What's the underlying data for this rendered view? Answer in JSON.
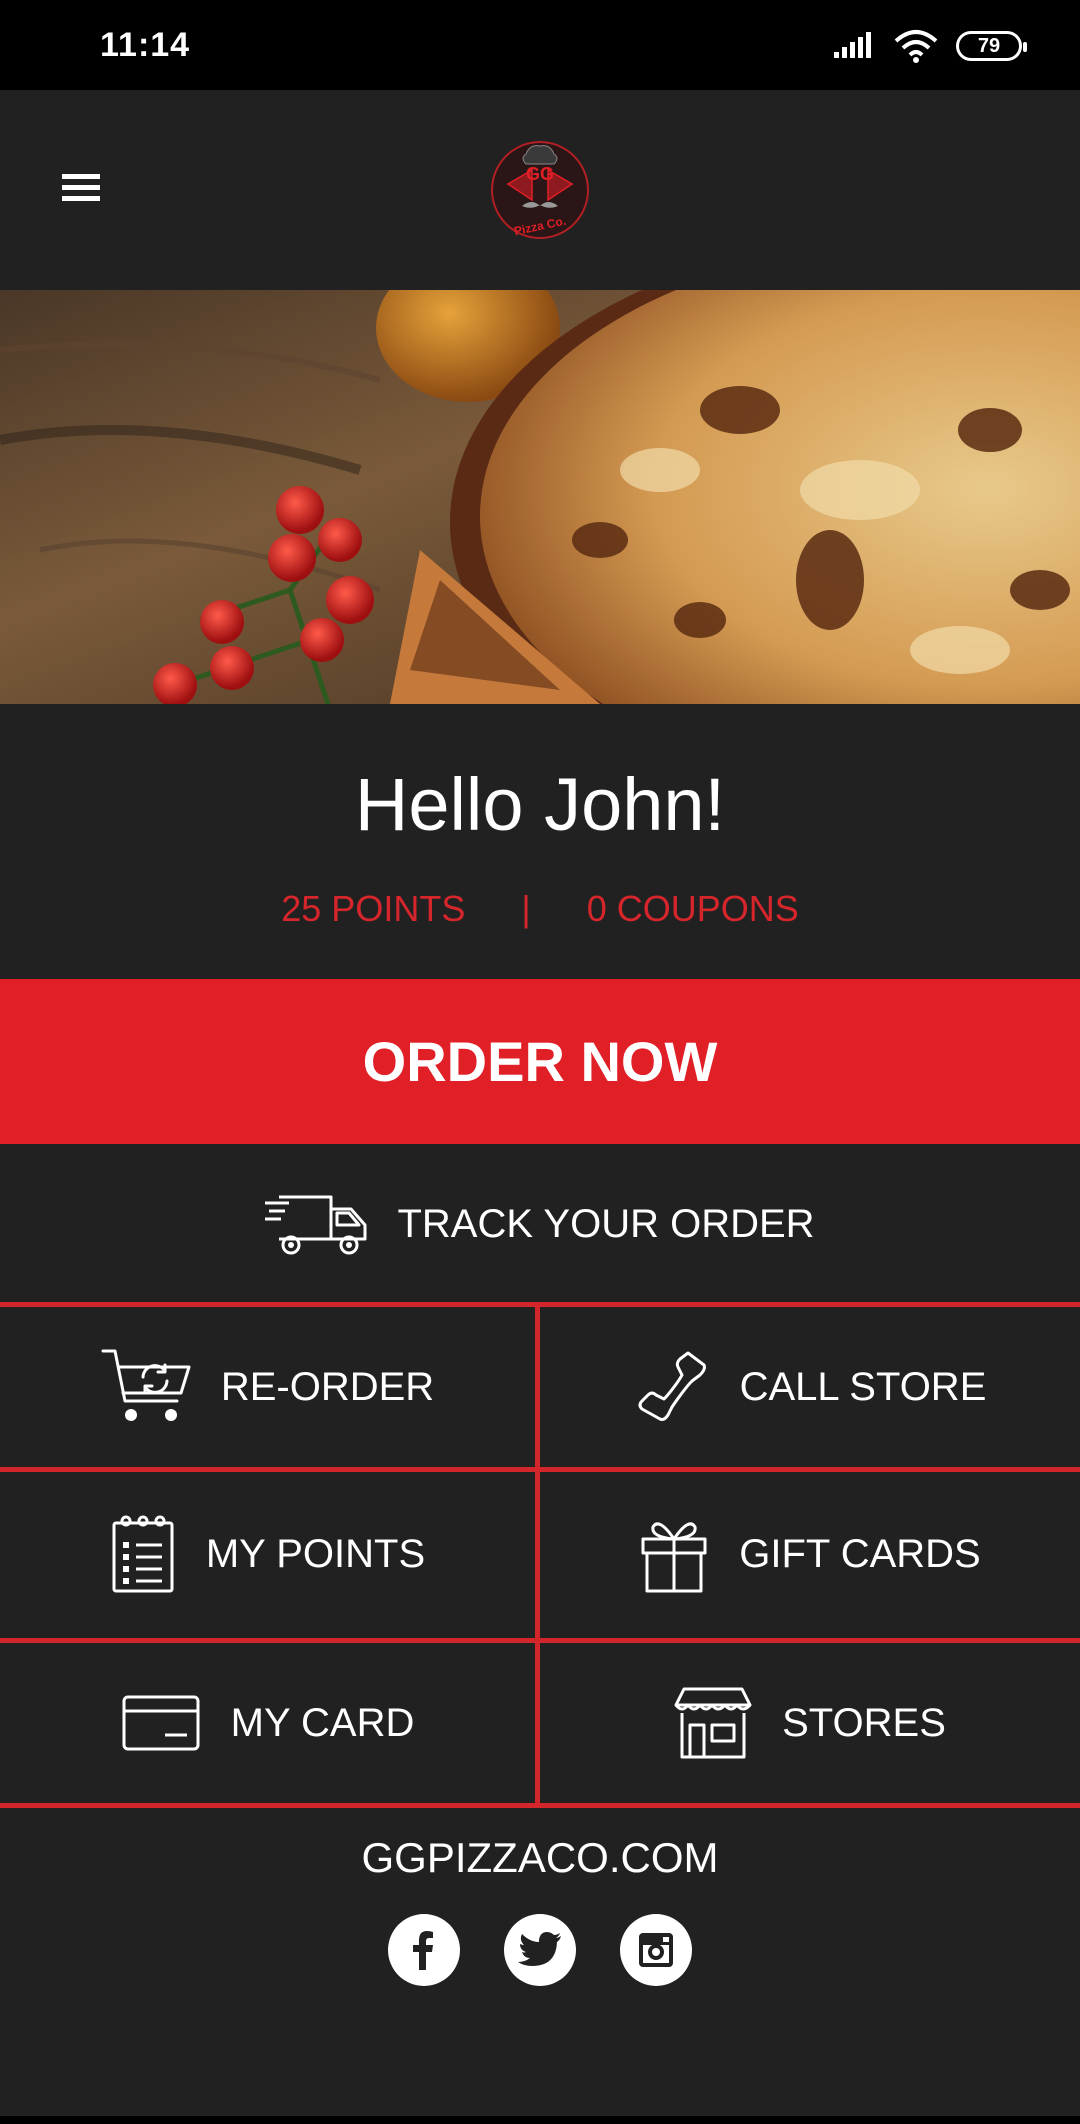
{
  "status_bar": {
    "time": "11:14",
    "battery": "79",
    "icons": [
      "signal-icon",
      "wifi-icon",
      "battery-icon"
    ]
  },
  "header": {
    "menu_icon": "hamburger-menu-icon",
    "logo_text_top": "GG",
    "logo_text_bottom": "Pizza Co."
  },
  "hero": {
    "image": "pizza-hero-image"
  },
  "greeting": "Hello John!",
  "stats": {
    "points": "25 POINTS",
    "separator": "|",
    "coupons": "0 COUPONS"
  },
  "order_now": "ORDER NOW",
  "track": {
    "label": "TRACK YOUR ORDER",
    "icon": "delivery-truck-icon"
  },
  "grid": [
    {
      "label": "RE-ORDER",
      "icon": "cart-reorder-icon"
    },
    {
      "label": "CALL STORE",
      "icon": "phone-icon"
    },
    {
      "label": "MY POINTS",
      "icon": "notepad-list-icon"
    },
    {
      "label": "GIFT CARDS",
      "icon": "gift-icon"
    },
    {
      "label": "MY CARD",
      "icon": "credit-card-icon"
    },
    {
      "label": "STORES",
      "icon": "storefront-icon"
    }
  ],
  "footer": {
    "website": "GGPIZZACO.COM",
    "socials": [
      "facebook-icon",
      "twitter-icon",
      "instagram-icon"
    ]
  },
  "colors": {
    "background": "#212121",
    "accent_red": "#e01f26",
    "stats_red": "#d6262c",
    "divider_red": "#d3262b",
    "status_bar": "#000000"
  }
}
